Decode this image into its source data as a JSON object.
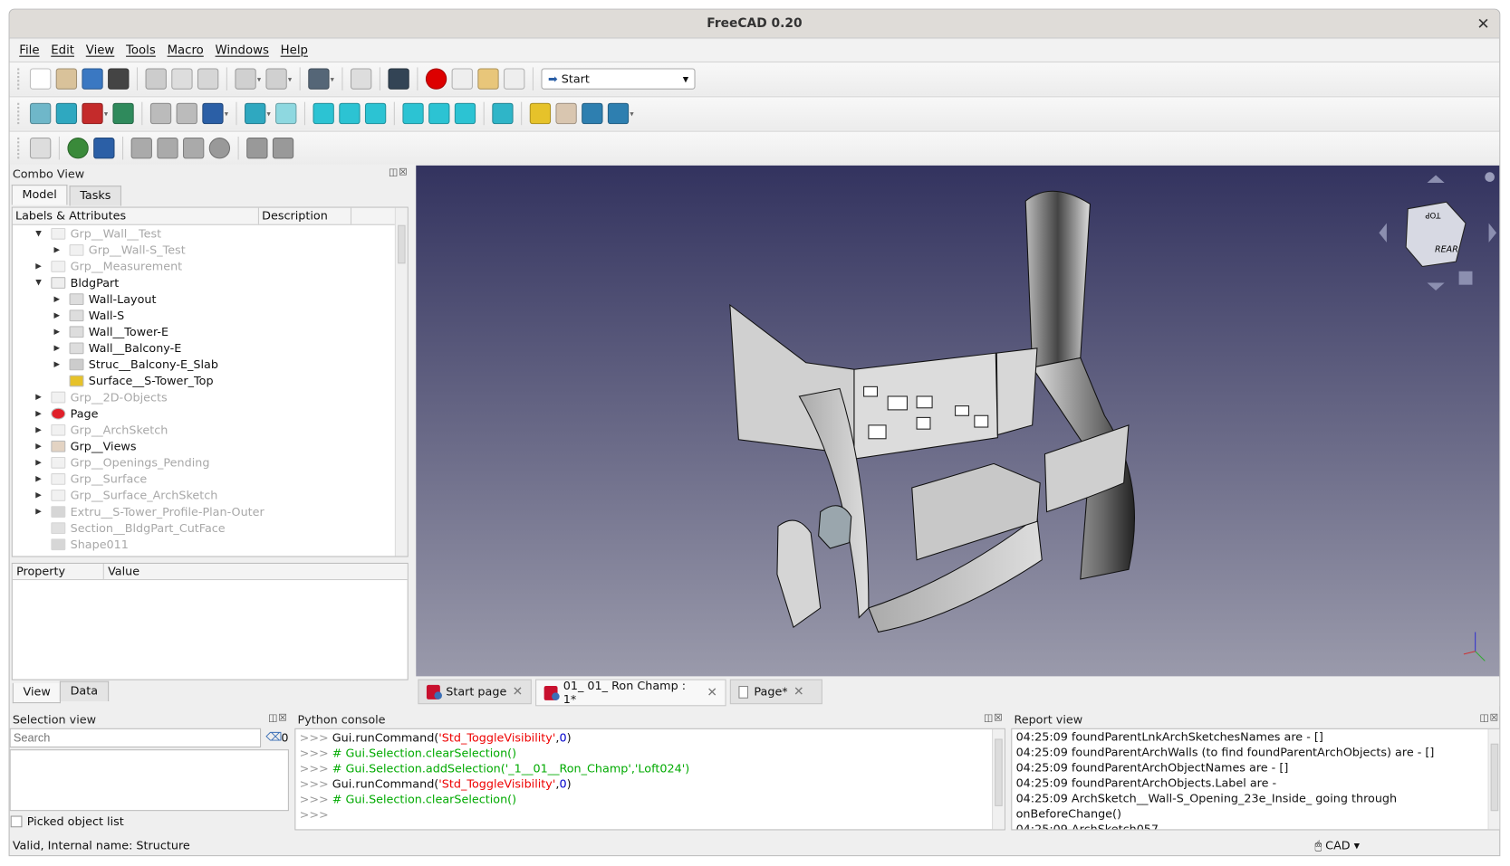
{
  "window": {
    "title": "FreeCAD 0.20",
    "close": "✕"
  },
  "menu": [
    "File",
    "Edit",
    "View",
    "Tools",
    "Macro",
    "Windows",
    "Help"
  ],
  "toolbars": [
    [
      {
        "n": "new-file",
        "c": "#ffffff"
      },
      {
        "n": "open-folder",
        "c": "#d9c29a"
      },
      {
        "n": "save",
        "c": "#3a78c2"
      },
      {
        "n": "print",
        "c": "#444444"
      },
      "|",
      {
        "n": "cut",
        "c": "#cccccc"
      },
      {
        "n": "copy",
        "c": "#dddddd"
      },
      {
        "n": "paste",
        "c": "#d6d6d6"
      },
      "|",
      {
        "n": "undo",
        "c": "#d0d0d0",
        "dd": true
      },
      {
        "n": "redo",
        "c": "#d0d0d0",
        "dd": true
      },
      "|",
      {
        "n": "refresh-check",
        "c": "#556677",
        "dd": true
      },
      "|",
      {
        "n": "recompute",
        "c": "#dddddd"
      },
      "|",
      {
        "n": "whats-this",
        "c": "#334455"
      },
      "|",
      {
        "n": "macro-record",
        "c": "#dd0000",
        "round": true
      },
      {
        "n": "macro-stop",
        "c": "#eeeeee"
      },
      {
        "n": "macro-edit",
        "c": "#e8c67a"
      },
      {
        "n": "macro-run",
        "c": "#eeeeee"
      }
    ],
    [
      {
        "n": "fit-all",
        "c": "#6fb7c9"
      },
      {
        "n": "fit-selection",
        "c": "#2fa8c0"
      },
      {
        "n": "draw-style",
        "c": "#c42b2b",
        "dd": true
      },
      {
        "n": "bounding-box",
        "c": "#2f8a5c"
      },
      "|",
      {
        "n": "back",
        "c": "#bbbbbb"
      },
      {
        "n": "forward",
        "c": "#bbbbbb"
      },
      {
        "n": "sync-view",
        "c": "#2b5fa6",
        "dd": true
      },
      "|",
      {
        "n": "zoom",
        "c": "#2fa8c0",
        "dd": true
      },
      {
        "n": "view-isometric",
        "c": "#8ed8e0"
      },
      "|",
      {
        "n": "view-front",
        "c": "#2cc3d3"
      },
      {
        "n": "view-top",
        "c": "#2cc3d3"
      },
      {
        "n": "view-right",
        "c": "#2cc3d3"
      },
      "|",
      {
        "n": "view-rear",
        "c": "#2cc3d3"
      },
      {
        "n": "view-bottom",
        "c": "#2cc3d3"
      },
      {
        "n": "view-left",
        "c": "#2cc3d3"
      },
      "|",
      {
        "n": "measure",
        "c": "#2fb5c8"
      },
      "|",
      {
        "n": "part",
        "c": "#e6c22a"
      },
      {
        "n": "group",
        "c": "#d9c6b0"
      },
      {
        "n": "link",
        "c": "#2e7fb0"
      },
      {
        "n": "link-actions",
        "c": "#2e7fb0",
        "dd": true
      }
    ],
    [
      {
        "n": "web-home",
        "c": "#dddddd"
      },
      "|",
      {
        "n": "web-globe",
        "c": "#3a8a3a",
        "round": true
      },
      {
        "n": "web-go",
        "c": "#2b5fa6"
      },
      "|",
      {
        "n": "web-back",
        "c": "#aaaaaa"
      },
      {
        "n": "web-forward",
        "c": "#aaaaaa"
      },
      {
        "n": "web-refresh",
        "c": "#aaaaaa"
      },
      {
        "n": "web-stop",
        "c": "#999999",
        "round": true
      },
      "|",
      {
        "n": "zoom-in",
        "c": "#999999"
      },
      {
        "n": "zoom-out",
        "c": "#999999"
      }
    ]
  ],
  "workbench": {
    "label": "Start",
    "arrow": "▾"
  },
  "combo": {
    "title": "Combo View",
    "tabs": [
      "Model",
      "Tasks"
    ],
    "columns": [
      "Labels & Attributes",
      "Description"
    ],
    "tree": [
      {
        "label": "Grp__Wall__Test",
        "lvl": 1,
        "exp": "open",
        "mute": true,
        "icon": "folder"
      },
      {
        "label": "Grp__Wall-S_Test",
        "lvl": 2,
        "exp": "closed",
        "mute": true,
        "icon": "folder"
      },
      {
        "label": "Grp__Measurement",
        "lvl": 1,
        "exp": "closed",
        "mute": true,
        "icon": "folder"
      },
      {
        "label": "BldgPart",
        "lvl": 1,
        "exp": "open",
        "mute": false,
        "icon": "building-part"
      },
      {
        "label": "Wall-Layout",
        "lvl": 2,
        "exp": "closed",
        "mute": false,
        "icon": "wall"
      },
      {
        "label": "Wall-S",
        "lvl": 2,
        "exp": "closed",
        "mute": false,
        "icon": "wall"
      },
      {
        "label": "Wall__Tower-E",
        "lvl": 2,
        "exp": "closed",
        "mute": false,
        "icon": "wall"
      },
      {
        "label": "Wall__Balcony-E",
        "lvl": 2,
        "exp": "closed",
        "mute": false,
        "icon": "wall"
      },
      {
        "label": "Struc__Balcony-E_Slab",
        "lvl": 2,
        "exp": "closed",
        "mute": false,
        "icon": "structure"
      },
      {
        "label": "Surface__S-Tower_Top",
        "lvl": 2,
        "exp": "none",
        "mute": false,
        "icon": "surface"
      },
      {
        "label": "Grp__2D-Objects",
        "lvl": 1,
        "exp": "closed",
        "mute": true,
        "icon": "folder"
      },
      {
        "label": "Page",
        "lvl": 1,
        "exp": "closed",
        "mute": false,
        "icon": "page-refresh"
      },
      {
        "label": "Grp__ArchSketch",
        "lvl": 1,
        "exp": "closed",
        "mute": true,
        "icon": "folder"
      },
      {
        "label": "Grp__Views",
        "lvl": 1,
        "exp": "closed",
        "mute": false,
        "icon": "folder-active"
      },
      {
        "label": "Grp__Openings_Pending",
        "lvl": 1,
        "exp": "closed",
        "mute": true,
        "icon": "folder"
      },
      {
        "label": "Grp__Surface",
        "lvl": 1,
        "exp": "closed",
        "mute": true,
        "icon": "folder"
      },
      {
        "label": "Grp__Surface_ArchSketch",
        "lvl": 1,
        "exp": "closed",
        "mute": true,
        "icon": "folder"
      },
      {
        "label": "Extru__S-Tower_Profile-Plan-Outer",
        "lvl": 1,
        "exp": "closed",
        "mute": true,
        "icon": "extrude"
      },
      {
        "label": "Section__BldgPart_CutFace",
        "lvl": 1,
        "exp": "none",
        "mute": true,
        "icon": "section"
      },
      {
        "label": "Shape011",
        "lvl": 1,
        "exp": "none",
        "mute": true,
        "icon": "shape"
      }
    ],
    "prop_columns": [
      "Property",
      "Value"
    ],
    "prop_tabs": [
      "View",
      "Data"
    ]
  },
  "navcube": {
    "top": "TOP",
    "face": "REAR"
  },
  "doc_tabs": [
    {
      "label": "Start page",
      "active": false
    },
    {
      "label": "01_ 01_ Ron Champ : 1*",
      "active": true
    },
    {
      "label": "Page*",
      "active": false
    }
  ],
  "selection": {
    "title": "Selection view",
    "placeholder": "Search",
    "count": "0",
    "picked": "Picked object list"
  },
  "python": {
    "title": "Python console",
    "lines": [
      [
        [
          "p",
          ">>> "
        ],
        [
          "k",
          "Gui.runCommand("
        ],
        [
          "r",
          "'Std_ToggleVisibility'"
        ],
        [
          "k",
          ","
        ],
        [
          "b",
          "0"
        ],
        [
          "k",
          ")"
        ]
      ],
      [
        [
          "p",
          ">>> "
        ],
        [
          "g",
          "# Gui.Selection.clearSelection()"
        ]
      ],
      [
        [
          "p",
          ">>> "
        ],
        [
          "g",
          "# Gui.Selection.addSelection('_1__01__Ron_Champ','Loft024')"
        ]
      ],
      [
        [
          "p",
          ">>> "
        ],
        [
          "k",
          "Gui.runCommand("
        ],
        [
          "r",
          "'Std_ToggleVisibility'"
        ],
        [
          "k",
          ","
        ],
        [
          "b",
          "0"
        ],
        [
          "k",
          ")"
        ]
      ],
      [
        [
          "p",
          ">>> "
        ],
        [
          "g",
          "# Gui.Selection.clearSelection()"
        ]
      ],
      [
        [
          "p",
          ">>> "
        ]
      ]
    ]
  },
  "report": {
    "title": "Report view",
    "lines": [
      "04:25:09  foundParentLnkArchSketchesNames are -  []",
      "04:25:09  foundParentArchWalls (to find foundParentArchObjects) are -  []",
      "04:25:09  foundParentArchObjectNames are -  []",
      "04:25:09  foundParentArchObjects.Label are -",
      "04:25:09  ArchSketch__Wall-S_Opening_23e_Inside_  going through",
      "onBeforeChange()",
      "04:25:09  ArchSketch057"
    ]
  },
  "status": {
    "text": "Valid, Internal name: Structure",
    "nav_style": "CAD"
  },
  "colors": {
    "view_top": "#33335f",
    "view_bottom": "#9a9aab",
    "accent": "#2cc3d3"
  }
}
